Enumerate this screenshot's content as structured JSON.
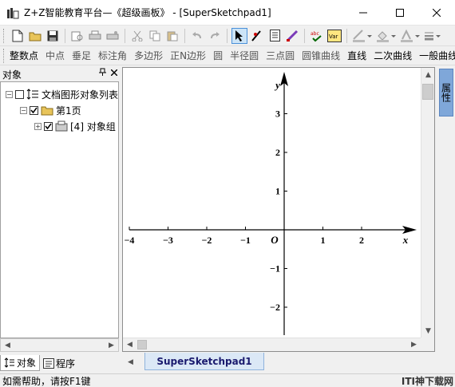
{
  "window": {
    "title": "Z+Z智能教育平台—《超级画板》 - [SuperSketchpad1]",
    "min_label": "—",
    "max_label": "☐",
    "close_label": "✕"
  },
  "toolbar1": {
    "buttons": [
      "new-icon",
      "open-icon",
      "save-icon",
      "print-preview-icon",
      "print-icon",
      "settings-icon",
      "cut-icon",
      "copy-icon",
      "paste-icon",
      "undo-icon",
      "redo-icon",
      "select-arrow-icon",
      "pen-tool-icon",
      "text-doc-icon",
      "brush-icon",
      "abc-check-icon",
      "var-icon",
      "line-color-icon",
      "fill-color-icon",
      "text-color-icon",
      "style-icon"
    ]
  },
  "toolbar2": {
    "items": [
      "整数点",
      "中点",
      "垂足",
      "标注角",
      "多边形",
      "正N边形",
      "圆",
      "半径圆",
      "三点圆",
      "圆锥曲线",
      "直线",
      "二次曲线",
      "一般曲线"
    ],
    "enabled": [
      "整数点",
      "直线",
      "二次曲线",
      "一般曲线"
    ]
  },
  "left_pane": {
    "title": "对象",
    "pin_label": "ᴾ",
    "close_label": "✕",
    "tree": {
      "root_label": "文档图形对象列表",
      "page_label": "第1页",
      "group_label": "[4] 对象组"
    },
    "tabs": {
      "objects_label": "对象",
      "program_label": "程序"
    }
  },
  "canvas": {
    "x_axis_label": "x",
    "y_axis_label": "y",
    "origin_label": "O",
    "x_ticks": [
      "−4",
      "−3",
      "−2",
      "−1",
      "1",
      "2"
    ],
    "y_ticks": [
      "3",
      "2",
      "1",
      "−1",
      "−2"
    ]
  },
  "doc_tab": {
    "label": "SuperSketchpad1"
  },
  "right_strip": {
    "property_label": "属性"
  },
  "status": {
    "text": "如需帮助，请按F1键",
    "watermark": "ITI神下载网"
  },
  "colors": {
    "accent": "#4a90d9",
    "tab_bg": "#dbe8f6",
    "property_tab": "#7fa7d9"
  }
}
